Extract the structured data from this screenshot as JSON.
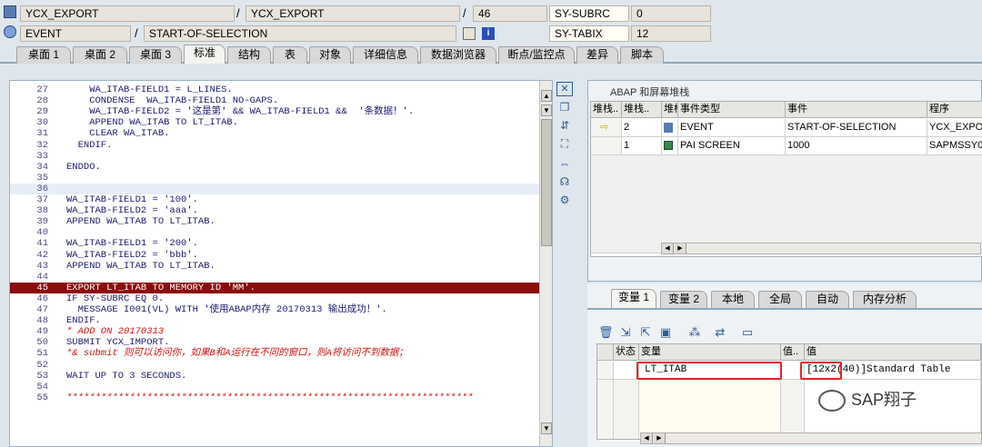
{
  "header": {
    "row1": {
      "program": "YCX_EXPORT",
      "include": "YCX_EXPORT",
      "line": "46",
      "sysvar": "SY-SUBRC",
      "sysval": "0"
    },
    "row2": {
      "event_type": "EVENT",
      "event_name": "START-OF-SELECTION",
      "sysvar": "SY-TABIX",
      "sysval": "12"
    }
  },
  "tabs": [
    "桌面 1",
    "桌面 2",
    "桌面 3",
    "标准",
    "结构",
    "表",
    "对象",
    "详细信息",
    "数据浏览器",
    "断点/监控点",
    "差异",
    "脚本"
  ],
  "active_tab": "标准",
  "code_lines": [
    {
      "n": "27",
      "t": "    WA_ITAB-FIELD1 = L_LINES."
    },
    {
      "n": "28",
      "t": "    CONDENSE  WA_ITAB-FIELD1 NO-GAPS."
    },
    {
      "n": "29",
      "t": "    WA_ITAB-FIELD2 = '这是第' && WA_ITAB-FIELD1 &&  '条数据！'."
    },
    {
      "n": "30",
      "t": "    APPEND WA_ITAB TO LT_ITAB."
    },
    {
      "n": "31",
      "t": "    CLEAR WA_ITAB."
    },
    {
      "n": "32",
      "t": "  ENDIF."
    },
    {
      "n": "33",
      "t": ""
    },
    {
      "n": "34",
      "t": "ENDDO."
    },
    {
      "n": "35",
      "t": ""
    },
    {
      "n": "36",
      "t": ""
    },
    {
      "n": "37",
      "t": "WA_ITAB-FIELD1 = '100'."
    },
    {
      "n": "38",
      "t": "WA_ITAB-FIELD2 = 'aaa'."
    },
    {
      "n": "39",
      "t": "APPEND WA_ITAB TO LT_ITAB."
    },
    {
      "n": "40",
      "t": ""
    },
    {
      "n": "41",
      "t": "WA_ITAB-FIELD1 = '200'."
    },
    {
      "n": "42",
      "t": "WA_ITAB-FIELD2 = 'bbb'."
    },
    {
      "n": "43",
      "t": "APPEND WA_ITAB TO LT_ITAB."
    },
    {
      "n": "44",
      "t": ""
    },
    {
      "n": "45",
      "t": "EXPORT LT_ITAB TO MEMORY ID 'MM'."
    },
    {
      "n": "46",
      "t": "IF SY-SUBRC EQ 0."
    },
    {
      "n": "47",
      "t": "  MESSAGE I001(VL) WITH '使用ABAP内存 20170313 输出成功！'."
    },
    {
      "n": "48",
      "t": "ENDIF."
    },
    {
      "n": "49",
      "t": "* ADD ON 20170313"
    },
    {
      "n": "50",
      "t": "SUBMIT YCX_IMPORT."
    },
    {
      "n": "51",
      "t": "*& submit 则可以访问你，如果B和A运行在不同的窗口，则A将访问不到数据；"
    },
    {
      "n": "52",
      "t": ""
    },
    {
      "n": "53",
      "t": "WAIT UP TO 3 SECONDS."
    },
    {
      "n": "54",
      "t": ""
    },
    {
      "n": "55",
      "t": "***********************************************************************"
    }
  ],
  "stack": {
    "title": "ABAP 和屏幕堆栈",
    "headers": [
      "堆栈..",
      "堆栈..",
      "堆栈",
      "事件类型",
      "事件",
      "程序"
    ],
    "rows": [
      {
        "c1": "",
        "c2": "2",
        "type": "EVENT",
        "event": "START-OF-SELECTION",
        "program": "YCX_EXPOR"
      },
      {
        "c1": "",
        "c2": "1",
        "type": "PAI SCREEN",
        "event": "1000",
        "program": "SAPMSSY0"
      }
    ]
  },
  "var_tabs": [
    "变量 1",
    "变量 2",
    "本地",
    "全局",
    "自动",
    "内存分析"
  ],
  "vars": {
    "headers": [
      "状态",
      "变量",
      "值..",
      "值"
    ],
    "rows": [
      {
        "status": "",
        "name": "LT_ITAB",
        "v1": "",
        "value": "[12x2(40)]Standard Table"
      }
    ]
  },
  "watermark": "SAP翔子"
}
